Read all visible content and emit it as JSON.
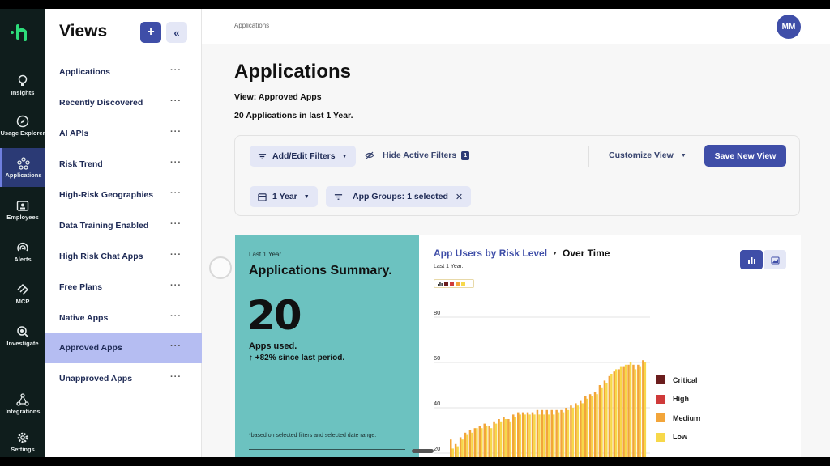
{
  "rail": {
    "items": [
      {
        "label": "Insights",
        "icon": "lightbulb-icon"
      },
      {
        "label": "Usage Explorer",
        "icon": "compass-icon"
      },
      {
        "label": "Applications",
        "icon": "apps-icon"
      },
      {
        "label": "Employees",
        "icon": "id-card-icon"
      },
      {
        "label": "Alerts",
        "icon": "broadcast-icon"
      },
      {
        "label": "MCP",
        "icon": "mcp-icon"
      },
      {
        "label": "Investigate",
        "icon": "magnify-icon"
      },
      {
        "label": "Integrations",
        "icon": "network-icon"
      },
      {
        "label": "Settings",
        "icon": "gear-icon"
      }
    ]
  },
  "views": {
    "title": "Views",
    "add_label": "+",
    "collapse_label": "«",
    "more_label": "···",
    "items": [
      "Applications",
      "Recently Discovered",
      "AI APIs",
      "Risk Trend",
      "High-Risk Geographies",
      "Data Training Enabled",
      "High Risk Chat Apps",
      "Free Plans",
      "Native Apps",
      "Approved Apps",
      "Unapproved Apps"
    ],
    "selected": "Approved Apps"
  },
  "header": {
    "breadcrumb": "Applications",
    "avatar_initials": "MM"
  },
  "page": {
    "title": "Applications",
    "view_line": "View: Approved Apps",
    "count_line": "20 Applications in last 1 Year."
  },
  "filters": {
    "add_edit": "Add/Edit Filters",
    "hide_active": "Hide Active Filters",
    "active_count": "1",
    "customize": "Customize View",
    "save": "Save New View",
    "period": "1 Year",
    "app_groups": "App Groups: 1 selected"
  },
  "summary": {
    "period": "Last 1 Year",
    "title": "Applications Summary.",
    "count": "20",
    "used_label": "Apps used.",
    "change": "↑ +82% since last period.",
    "footnote": "*based on selected filters and selected date range."
  },
  "chart": {
    "title": "App Users by Risk Level",
    "title_suffix": "Over Time",
    "subtitle": "Last 1 Year.",
    "colors": {
      "Critical": "#6b1d1d",
      "High": "#cf3a3a",
      "Medium": "#f2a53a",
      "Low": "#f7d84a",
      "accent": "#3f4ea8"
    }
  },
  "chart_data": {
    "type": "bar",
    "ylim": [
      20,
      80
    ],
    "yticks": [
      "80",
      "60",
      "40",
      "20"
    ],
    "legend": [
      "Critical",
      "High",
      "Medium",
      "Low"
    ],
    "legend_position": "right",
    "series": [
      {
        "name": "Medium",
        "values": [
          26,
          24,
          27,
          29,
          30,
          31,
          32,
          33,
          32,
          34,
          35,
          36,
          35,
          37,
          38,
          38,
          38,
          38,
          39,
          39,
          39,
          39,
          39,
          39,
          40,
          41,
          42,
          43,
          45,
          46,
          47,
          50,
          52,
          54,
          56,
          57,
          58,
          59,
          59,
          59,
          61
        ]
      },
      {
        "name": "Low",
        "values": [
          22,
          23,
          26,
          28,
          29,
          31,
          31,
          32,
          31,
          33,
          34,
          35,
          34,
          36,
          37,
          37,
          37,
          37,
          37,
          37,
          37,
          37,
          38,
          38,
          39,
          40,
          41,
          42,
          44,
          45,
          46,
          49,
          51,
          55,
          57,
          58,
          59,
          60,
          57,
          58,
          60
        ]
      }
    ]
  }
}
